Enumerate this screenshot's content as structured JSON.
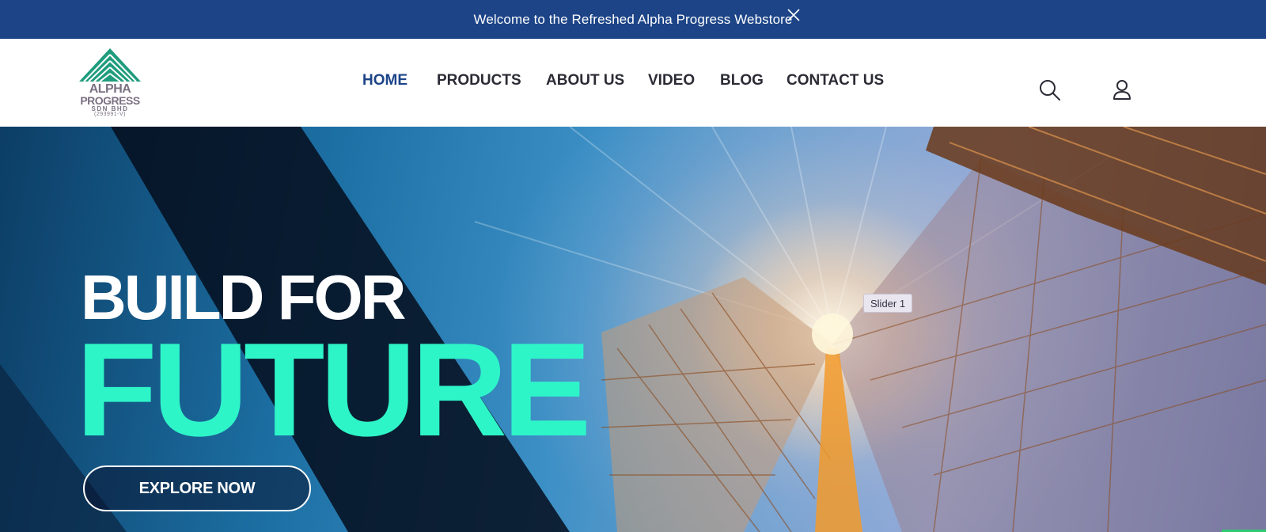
{
  "announcement": {
    "text": "Welcome to the Refreshed Alpha Progress Webstore",
    "close_icon": "close-icon"
  },
  "logo": {
    "line1": "ALPHA",
    "line2": "PROGRESS",
    "line3": "SDN BHD",
    "line4": "(293991-V)"
  },
  "nav": {
    "items": [
      {
        "label": "HOME",
        "active": true
      },
      {
        "label": "PRODUCTS",
        "active": false
      },
      {
        "label": "ABOUT US",
        "active": false
      },
      {
        "label": "VIDEO",
        "active": false
      },
      {
        "label": "BLOG",
        "active": false
      },
      {
        "label": "CONTACT US",
        "active": false
      }
    ]
  },
  "header_icons": {
    "search": "search-icon",
    "account": "user-icon"
  },
  "hero": {
    "headline_1": "BUILD FOR",
    "headline_2": "FUTURE",
    "cta_label": "EXPLORE NOW",
    "slider_label": "Slider 1"
  },
  "colors": {
    "announcement_bg": "#1c4487",
    "nav_active": "#1c4487",
    "nav_text": "#2b2b35",
    "headline_accent": "#2ef5c8",
    "logo_green": "#1f9c7d"
  }
}
